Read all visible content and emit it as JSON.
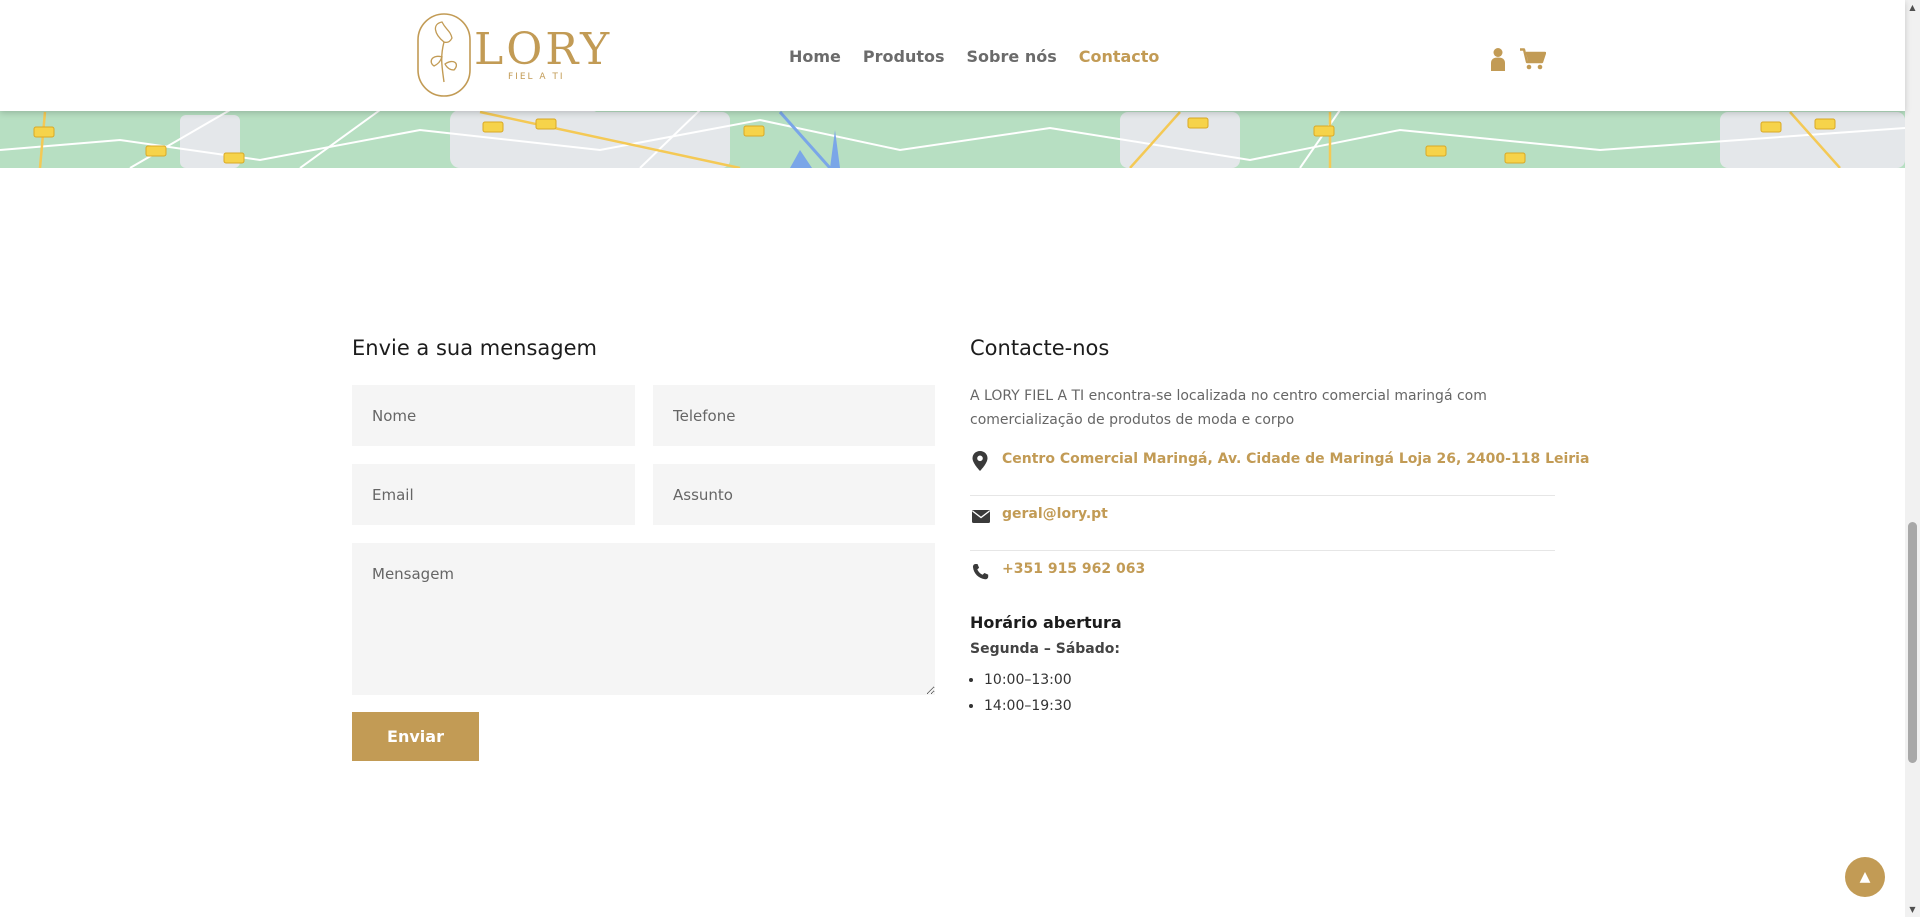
{
  "header": {
    "logo": {
      "name": "LORY",
      "tagline": "FIEL A TI"
    },
    "nav": [
      {
        "label": "Home",
        "active": false
      },
      {
        "label": "Produtos",
        "active": false
      },
      {
        "label": "Sobre nós",
        "active": false
      },
      {
        "label": "Contacto",
        "active": true
      }
    ],
    "icons": [
      "user-icon",
      "cart-icon"
    ]
  },
  "form": {
    "title": "Envie a sua mensagem",
    "fields": {
      "name": "Nome",
      "phone": "Telefone",
      "email": "Email",
      "subject": "Assunto",
      "message": "Mensagem"
    },
    "submit_label": "Enviar"
  },
  "contact": {
    "title": "Contacte-nos",
    "description": "A LORY FIEL A TI encontra-se localizada no centro comercial maringá com comercialização de produtos de moda e corpo",
    "address": "Centro Comercial Maringá, Av. Cidade de Maringá Loja 26, 2400-118 Leiria",
    "email": "geral@lory.pt",
    "phone": "+351 915 962 063",
    "hours": {
      "title": "Horário abertura",
      "days": "Segunda – Sábado:",
      "slots": [
        "10:00–13:00",
        "14:00–19:30"
      ]
    }
  },
  "colors": {
    "accent": "#c29b55",
    "map_green": "#b7dfc2"
  }
}
